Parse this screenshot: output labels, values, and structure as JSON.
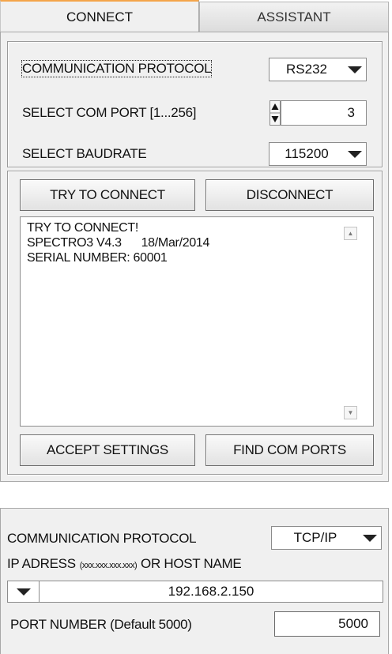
{
  "tabs": [
    {
      "label": "CONNECT"
    },
    {
      "label": "ASSISTANT"
    }
  ],
  "protocol_group": {
    "protocol_label": "COMMUNICATION PROTOCOL",
    "protocol_value": "RS232",
    "com_port_label": "SELECT COM PORT [1...256]",
    "com_port_value": "3",
    "baudrate_label": "SELECT BAUDRATE",
    "baudrate_value": "115200"
  },
  "connect_group": {
    "try_connect_label": "TRY TO CONNECT",
    "disconnect_label": "DISCONNECT",
    "log_lines": [
      "TRY TO CONNECT!",
      "SPECTRO3 V4.3      18/Mar/2014",
      "SERIAL NUMBER: 60001"
    ],
    "accept_label": "ACCEPT SETTINGS",
    "find_ports_label": "FIND COM PORTS"
  },
  "tcp_panel": {
    "protocol_label": "COMMUNICATION PROTOCOL",
    "protocol_value": "TCP/IP",
    "ip_label_prefix": "IP ADRESS",
    "ip_label_format": "(xxx.xxx.xxx.xxx)",
    "ip_label_suffix": "OR HOST NAME",
    "ip_value": "192.168.2.150",
    "port_label": "PORT NUMBER (Default 5000)",
    "port_value": "5000"
  },
  "colors": {
    "active_tab_accent": "#f4a54a",
    "panel_background": "#f0f0f0"
  }
}
